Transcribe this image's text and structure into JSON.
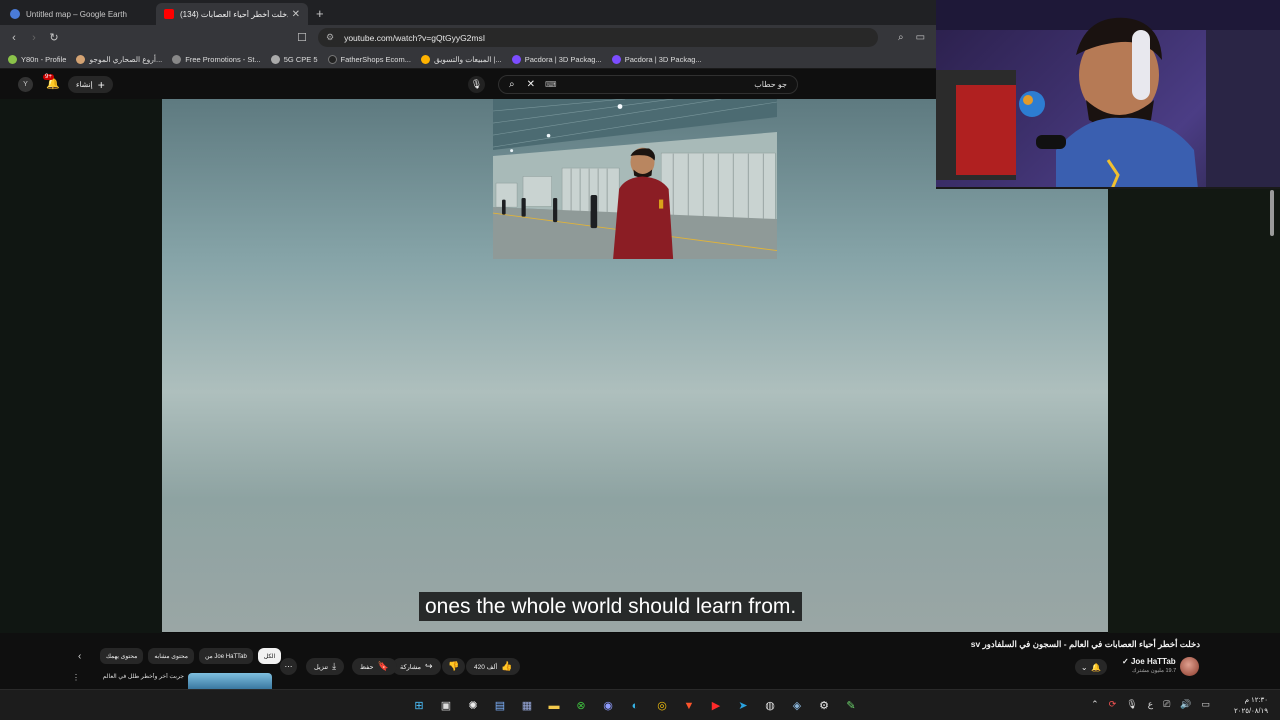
{
  "browser": {
    "tabs": [
      {
        "title": "Untitled map – Google Earth",
        "favicon_color": "#4a7bd8",
        "active": false
      },
      {
        "title": "(134) دخلت أخطر أحياء العصابات ...",
        "favicon_color": "#ff0000",
        "active": true
      }
    ],
    "new_tab_glyph": "+",
    "close_glyph": "✕",
    "url": "youtube.com/watch?v=gQtGyyG2msI",
    "bookmarks": [
      {
        "label": "Y80n - Profile",
        "color": "#8bc34a"
      },
      {
        "label": "أروع الصحاري الموجو...",
        "color": "#d4a373"
      },
      {
        "label": "Free Promotions - St...",
        "color": "#888888"
      },
      {
        "label": "5G CPE 5",
        "color": "#aaaaaa"
      },
      {
        "label": "FatherShops Ecom...",
        "color": "#222222"
      },
      {
        "label": "المبيعات والتسويق |...",
        "color": "#ffb300"
      },
      {
        "label": "Pacdora | 3D Packag...",
        "color": "#7c4dff"
      },
      {
        "label": "Pacdora | 3D Packag...",
        "color": "#7c4dff"
      }
    ]
  },
  "youtube": {
    "avatar_letter": "Y",
    "notif_count": "9+",
    "create_label": "إنشاء",
    "search_value": "جو حطاب",
    "keyboard_glyph": "⌨"
  },
  "video": {
    "subtitle": "ones the whole world should learn from.",
    "title": "دخلت أخطر أحياء العصابات في العالم - السجون في السلفادور sv",
    "channel": "Joe HaTTab",
    "subscribers": "19.7 مليون مشترك",
    "likes": "420 ألف",
    "share_label": "مشاركة",
    "save_label": "حفظ",
    "download_label": "تنزيل"
  },
  "chips": [
    {
      "label": "الكل",
      "active": true
    },
    {
      "label": "من Joe HaTTab",
      "active": false
    },
    {
      "label": "محتوى مشابه",
      "active": false
    },
    {
      "label": "محتوى يهمك",
      "active": false
    }
  ],
  "recommended": {
    "title": "جربت أخر وأخطر طلل في العالم"
  },
  "taskbar": {
    "clock_time": "١٢:٣٠ م",
    "clock_date": "٢٠٢٥/٠٨/١٩",
    "lang": "ع"
  }
}
